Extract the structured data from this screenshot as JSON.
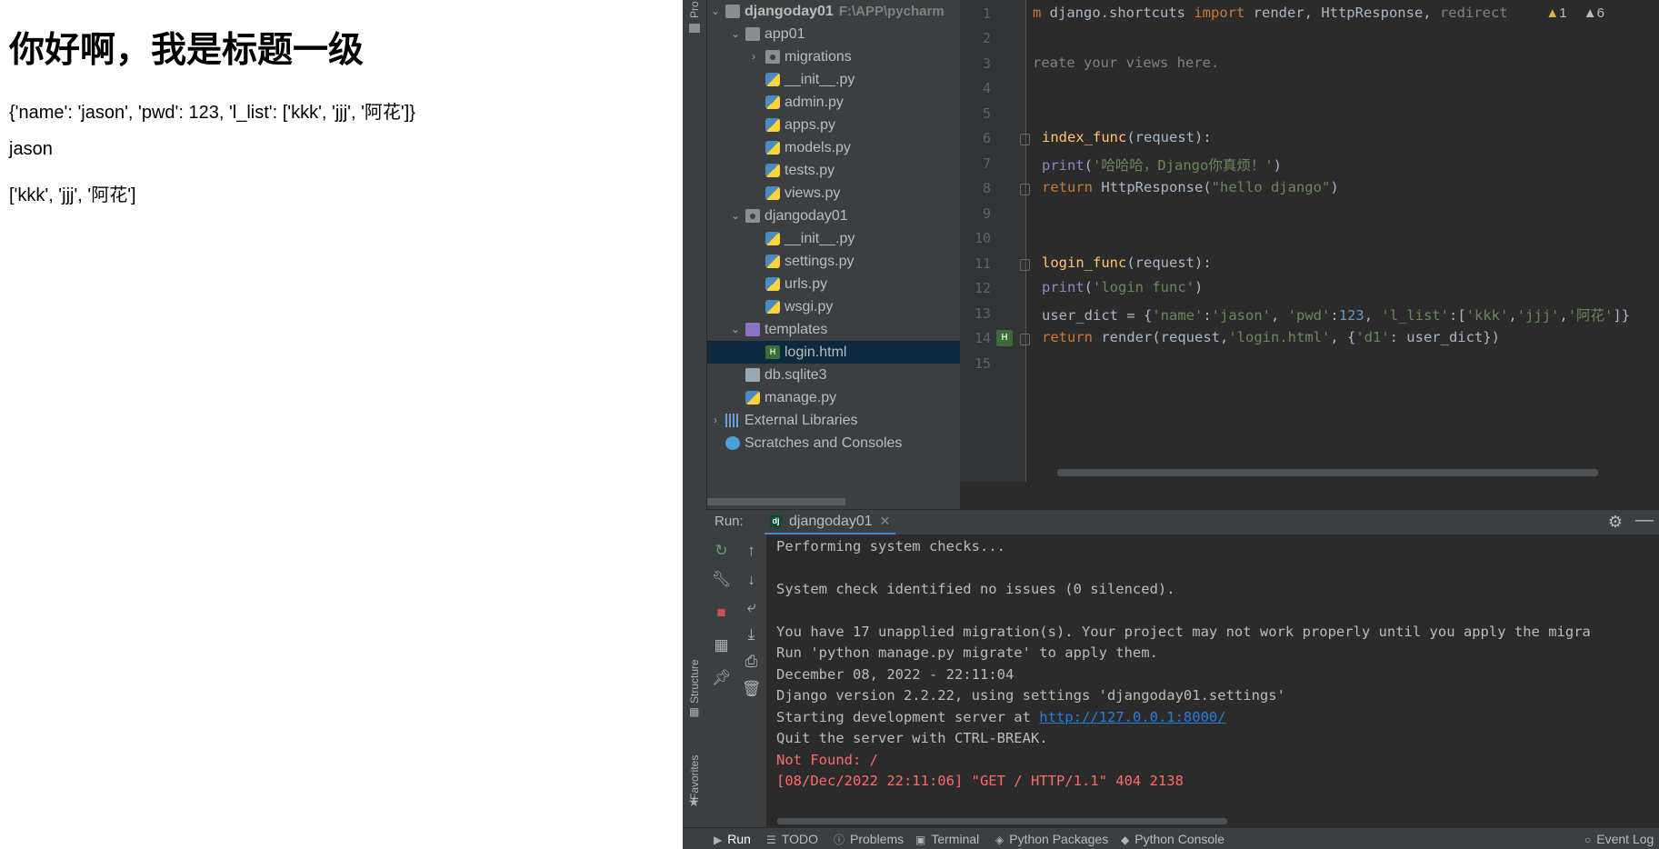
{
  "browser": {
    "heading": "你好啊，我是标题一级",
    "lines": [
      "{'name': 'jason', 'pwd': 123, 'l_list': ['kkk', 'jjj', '阿花']}",
      "jason",
      "['kkk', 'jjj', '阿花']"
    ]
  },
  "ide": {
    "side_tabs": {
      "project": "Pro",
      "structure": "Structure",
      "favorites": "Favorites"
    },
    "project_tree": {
      "root": {
        "name": "djangoday01",
        "path": "F:\\APP\\pycharm"
      },
      "items": [
        {
          "label": "app01"
        },
        {
          "label": "migrations"
        },
        {
          "label": "__init__.py"
        },
        {
          "label": "admin.py"
        },
        {
          "label": "apps.py"
        },
        {
          "label": "models.py"
        },
        {
          "label": "tests.py"
        },
        {
          "label": "views.py"
        },
        {
          "label": "djangoday01"
        },
        {
          "label": "__init__.py"
        },
        {
          "label": "settings.py"
        },
        {
          "label": "urls.py"
        },
        {
          "label": "wsgi.py"
        },
        {
          "label": "templates"
        },
        {
          "label": "login.html"
        },
        {
          "label": "db.sqlite3"
        },
        {
          "label": "manage.py"
        },
        {
          "label": "External Libraries"
        },
        {
          "label": "Scratches and Consoles"
        }
      ]
    },
    "editor": {
      "warnings_count": "1",
      "weak_warnings_count": "6",
      "line_numbers": [
        "1",
        "2",
        "3",
        "4",
        "5",
        "6",
        "7",
        "8",
        "9",
        "10",
        "11",
        "12",
        "13",
        "14",
        "15"
      ],
      "code": {
        "l1_kw1": "m",
        "l1_mod": " django.shortcuts ",
        "l1_kw2": "import",
        "l1_rest": " render, HttpResponse, ",
        "l1_unused": "redirect",
        "l3": "reate your views here.",
        "l6_name": "index_func",
        "l6_rest": "(request):",
        "l7_print": "print",
        "l7_open": "(",
        "l7_str": "'哈哈哈，Django你真烦！'",
        "l7_close": ")",
        "l8_kw": "return",
        "l8_mid": " HttpResponse(",
        "l8_str": "\"hello django\"",
        "l8_close": ")",
        "l11_name": "login_func",
        "l11_rest": "(request):",
        "l12_print": "print",
        "l12_open": "(",
        "l12_str": "'login func'",
        "l12_close": ")",
        "l13_a": "user_dict = {",
        "l13_s1": "'name'",
        "l13_c1": ":",
        "l13_s2": "'jason'",
        "l13_c2": ", ",
        "l13_s3": "'pwd'",
        "l13_c3": ":",
        "l13_n": "123",
        "l13_c4": ", ",
        "l13_s4": "'l_list'",
        "l13_c5": ":[",
        "l13_s5": "'kkk'",
        "l13_c6": ",",
        "l13_s6": "'jjj'",
        "l13_c7": ",",
        "l13_s7": "'阿花'",
        "l13_c8": "]}",
        "l14_kw": "return",
        "l14_mid": " render(request",
        "l14_c1": ",",
        "l14_s1": "'login.html'",
        "l14_c2": ", {",
        "l14_s2": "'d1'",
        "l14_c3": ": user_dict})"
      }
    },
    "run": {
      "label": "Run:",
      "tab": "djangoday01",
      "console": {
        "l1": "Performing system checks...",
        "l2": "System check identified no issues (0 silenced).",
        "l3": "You have 17 unapplied migration(s). Your project may not work properly until you apply the migra",
        "l4": "Run 'python manage.py migrate' to apply them.",
        "l5": "December 08, 2022 - 22:11:04",
        "l6": "Django version 2.2.22, using settings 'djangoday01.settings'",
        "l7_prefix": "Starting development server at ",
        "l7_link": "http://127.0.0.1:8000/",
        "l8": "Quit the server with CTRL-BREAK.",
        "l9": "Not Found: /",
        "l10": "[08/Dec/2022 22:11:06] \"GET / HTTP/1.1\" 404 2138"
      }
    },
    "bottom_tabs": [
      "Run",
      "TODO",
      "Problems",
      "Terminal",
      "Python Packages",
      "Python Console",
      "Event Log"
    ],
    "colors": {
      "keyword": "#cc7832",
      "function": "#ffc66d",
      "string": "#6a8759",
      "number": "#6897bb",
      "error": "#ff6b68",
      "link": "#287bde",
      "selection": "#0d293e"
    }
  }
}
